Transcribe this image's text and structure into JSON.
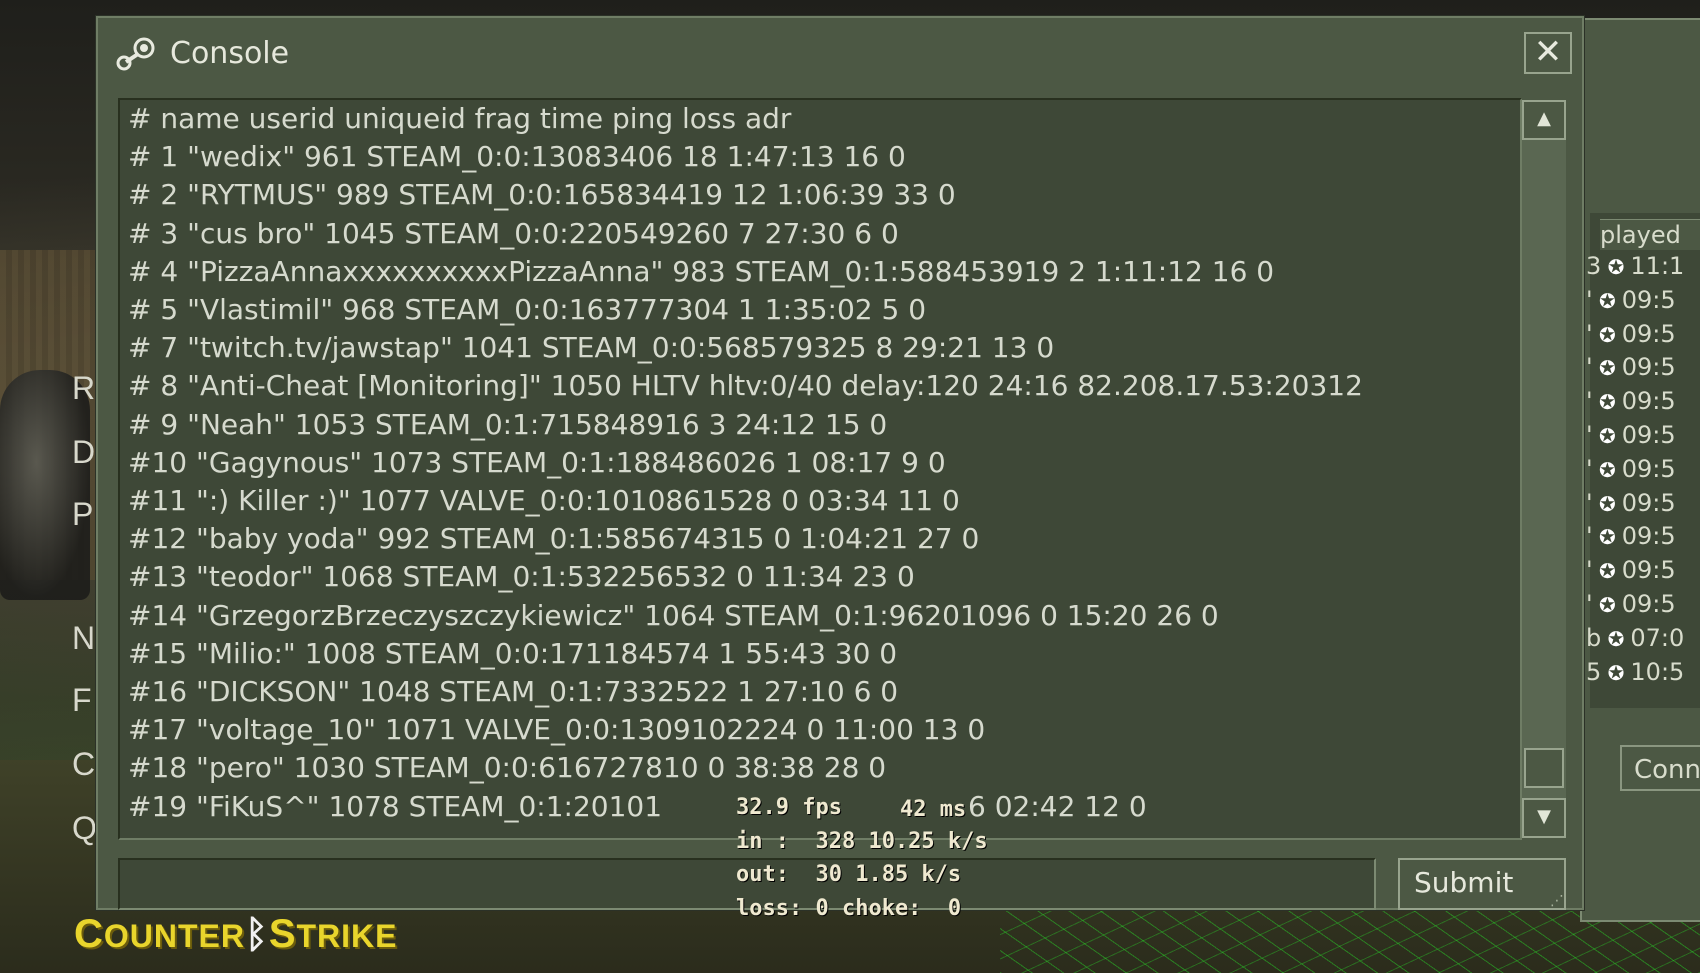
{
  "background": {
    "menu_letters": [
      "R",
      "D",
      "P",
      "N",
      "F",
      "C",
      "Q"
    ],
    "logo": {
      "part1_big": "C",
      "part1_small": "OUNTER",
      "part2_big": "S",
      "part2_small": "TRIKE"
    },
    "back_window": {
      "played_header": "played",
      "rows": [
        {
          "prefix": "3",
          "time": "11:1"
        },
        {
          "prefix": "'",
          "time": "09:5"
        },
        {
          "prefix": "'",
          "time": "09:5"
        },
        {
          "prefix": "'",
          "time": "09:5"
        },
        {
          "prefix": "'",
          "time": "09:5"
        },
        {
          "prefix": "'",
          "time": "09:5"
        },
        {
          "prefix": "'",
          "time": "09:5"
        },
        {
          "prefix": "'",
          "time": "09:5"
        },
        {
          "prefix": "'",
          "time": "09:5"
        },
        {
          "prefix": "'",
          "time": "09:5"
        },
        {
          "prefix": "'",
          "time": "09:5"
        },
        {
          "prefix": "b",
          "time": "07:0"
        },
        {
          "prefix": "5",
          "time": "10:5"
        }
      ],
      "button_label": "Conn"
    }
  },
  "console": {
    "title": "Console",
    "close_label": "✕",
    "submit_label": "Submit",
    "input_value": "",
    "lines": [
      "#      name userid uniqueid frag time ping loss adr",
      "# 1  \"wedix\" 961 STEAM_0:0:13083406  18  1:47:13   16    0",
      "# 2 \"RYTMUS\" 989 STEAM_0:0:165834419  12  1:06:39   33    0",
      "# 3 \"cus bro\" 1045 STEAM_0:0:220549260   7 27:30    6    0",
      "# 4 \"PizzaAnnaxxxxxxxxxxPizzaAnna\" 983 STEAM_0:1:588453919   2  1:11:12   16    0",
      "# 5 \"Vlastimil\" 968 STEAM_0:0:163777304   1  1:35:02    5    0",
      "# 7 \"twitch.tv/jawstap\" 1041 STEAM_0:0:568579325   8 29:21   13    0",
      "# 8 \"Anti-Cheat [Monitoring]\" 1050 HLTV hltv:0/40 delay:120 24:16 82.208.17.53:20312",
      "# 9   \"Neah\" 1053 STEAM_0:1:715848916   3 24:12   15    0",
      "#10 \"Gagynous\" 1073 STEAM_0:1:188486026   1 08:17    9    0",
      "#11 \":) Killer :)\" 1077 VALVE_0:0:1010861528   0 03:34   11    0",
      "#12 \"baby yoda\" 992 STEAM_0:1:585674315   0  1:04:21   27    0",
      "#13 \"teodor\" 1068 STEAM_0:1:532256532   0 11:34   23    0",
      "#14 \"GrzegorzBrzeczyszczykiewicz\" 1064 STEAM_0:1:96201096   0 15:20   26    0",
      "#15 \"Milio:\" 1008 STEAM_0:0:171184574   1 55:43   30    0",
      "#16 \"DICKSON\" 1048 STEAM_0:1:7332522   1 27:10    6    0",
      "#17 \"voltage_10\" 1071 VALVE_0:0:1309102224   0 11:00   13    0",
      "#18   \"pero\" 1030 STEAM_0:0:616727810   0 38:38   28    0",
      "#19 \"FiKuS^\" 1078 STEAM_0:1:20101"
    ],
    "line19_tail": "6 02:42   12    0"
  },
  "netgraph": {
    "fps": "32.9 fps",
    "ms": "42 ms",
    "in": "in :  328 10.25 k/s",
    "out": "out:  30 1.85 k/s",
    "loss": "loss: 0 choke:  0"
  }
}
